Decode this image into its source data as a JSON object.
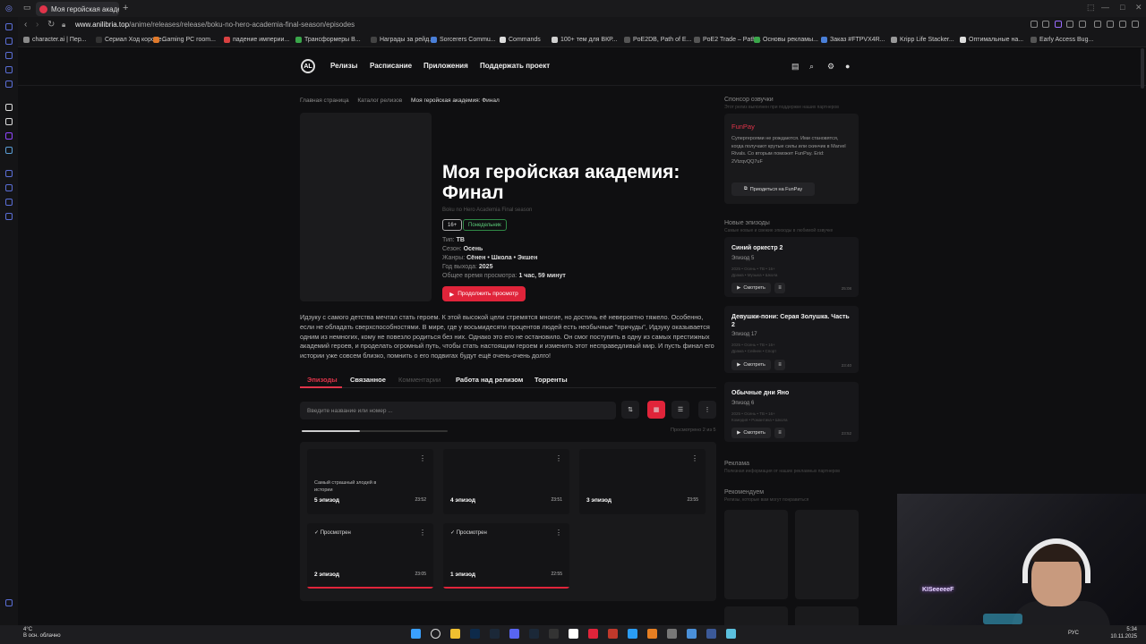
{
  "browser": {
    "tab_title": "Моя геройская академи",
    "url_domain": "www.anilibria.top",
    "url_path": "/anime/releases/release/boku-no-hero-academia-final-season/episodes",
    "bookmarks": [
      {
        "label": "character.ai | Пер...",
        "color": "#8a8a8a"
      },
      {
        "label": "Сериал Ход короле...",
        "color": "#333333"
      },
      {
        "label": "Gaming PC room...",
        "color": "#e07a2c"
      },
      {
        "label": "падение империи...",
        "color": "#d94141"
      },
      {
        "label": "Трансформеры В...",
        "color": "#3aa64a"
      },
      {
        "label": "Награды за рейд...",
        "color": "#444444"
      },
      {
        "label": "Sorcerers Commu...",
        "color": "#4a7fd8"
      },
      {
        "label": "Commands",
        "color": "#dddddd"
      },
      {
        "label": "100+ тем для ВКР...",
        "color": "#d0d0d0"
      },
      {
        "label": "PoE2DB, Path of E...",
        "color": "#555555"
      },
      {
        "label": "PoE2 Trade – Path...",
        "color": "#555555"
      },
      {
        "label": "Основы рекламы...",
        "color": "#3aa64a"
      },
      {
        "label": "Заказ #FTPVX4R...",
        "color": "#4a7fd8"
      },
      {
        "label": "Kripp Life Stacker...",
        "color": "#999999"
      },
      {
        "label": "Оптимальные на...",
        "color": "#dddddd"
      },
      {
        "label": "Early Access Bug...",
        "color": "#555555"
      }
    ]
  },
  "site": {
    "logo_text": "AL",
    "nav": [
      "Релизы",
      "Расписание",
      "Приложения",
      "Поддержать проект"
    ]
  },
  "breadcrumbs": [
    "Главная страница",
    "Каталог релизов",
    "Моя геройская академия: Финал"
  ],
  "release": {
    "title": "Моя геройская академия: Финал",
    "subtitle": "Boku no Hero Academia Final season",
    "age_badge": "16+",
    "day_badge": "Понедельник",
    "type_label": "Тип:",
    "type_value": "ТВ",
    "season_label": "Сезон:",
    "season_value": "Осень",
    "genres_label": "Жанры:",
    "genres_value": "Сёнен • Школа • Экшен",
    "year_label": "Год выхода:",
    "year_value": "2025",
    "total_label": "Общее время просмотра:",
    "total_value": "1 час, 59 минут",
    "continue_label": "Продолжить просмотр",
    "description": "Идзуку с самого детства мечтал стать героем. К этой высокой цели стремятся многие, но достичь её невероятно тяжело. Особенно, если не обладать сверхспособностями. В мире, где у восьмидесяти процентов людей есть необычные \"причуды\", Идзуку оказывается одним из немногих, кому не повезло родиться без них. Однако это его не остановило. Он смог поступить в одну из самых престижных академий героев, и проделать огромный путь, чтобы стать настоящим героем и изменить этот несправедливый мир. И пусть финал его истории уже совсем близко, помнить о его подвигах будут ещё очень-очень долго!"
  },
  "tabs": [
    "Эпизоды",
    "Связанное",
    "Комментарии",
    "Работа над релизом",
    "Торренты"
  ],
  "episodes_panel": {
    "search_placeholder": "Введите название или номер ...",
    "viewed_text": "Просмотрено 2 из 5",
    "progress_fraction": 0.4,
    "items": [
      {
        "title": "5 эпизод",
        "note": "Самый страшный злодей в истории",
        "time": "23:52",
        "watched": "",
        "progress": 0
      },
      {
        "title": "4 эпизод",
        "note": "",
        "time": "23:51",
        "watched": "",
        "progress": 0
      },
      {
        "title": "3 эпизод",
        "note": "",
        "time": "23:55",
        "watched": "",
        "progress": 0
      },
      {
        "title": "2 эпизод",
        "note": "",
        "time": "23:05",
        "watched": "Просмотрен",
        "progress": 1
      },
      {
        "title": "1 эпизод",
        "note": "",
        "time": "22:55",
        "watched": "Просмотрен",
        "progress": 1
      }
    ]
  },
  "sponsor": {
    "heading": "Спонсор озвучки",
    "subheading": "Этот релиз выполнен при поддержке наших партнеров",
    "name": "FunPay",
    "text": "Супергероями не рождаются. Ими становятся, когда получают крутые силы или скинчик в Marvel Rivals. Со вторым поможет FunPay. Erid: 2VtzqvQQ7uF",
    "button": "Приодеться на FunPay"
  },
  "new_episodes": {
    "heading": "Новые эпизоды",
    "subheading": "Самые новые и свежие эпизоды в любимой озвучке",
    "watch_label": "Смотреть",
    "items": [
      {
        "title": "Синий оркестр 2",
        "episode": "Эпизод 5",
        "meta1": "2025 • Осень • ТВ • 16+",
        "meta2": "Драма • Музыка • Школа",
        "time": "25:08"
      },
      {
        "title": "Девушки-пони: Серая Золушка. Часть 2",
        "episode": "Эпизод 17",
        "meta1": "2025 • Осень • ТВ • 16+",
        "meta2": "Драма • Сейнен • Спорт",
        "time": "23:40"
      },
      {
        "title": "Обычные дни Яно",
        "episode": "Эпизод 6",
        "meta1": "2025 • Осень • ТВ • 16+",
        "meta2": "Комедия • Романтика • Школа",
        "time": "23:52"
      }
    ]
  },
  "ads": {
    "heading": "Реклама",
    "subheading": "Полезная информация от наших рекламных партнеров"
  },
  "recommended": {
    "heading": "Рекомендуем",
    "subheading": "Релизы, которые вам могут понравиться"
  },
  "webcam_sign": "KISeeeeeF",
  "taskbar": {
    "temp": "4°C",
    "weather": "В осн. облачно",
    "lang": "РУС",
    "time": "5:34",
    "date": "10.11.2025"
  }
}
